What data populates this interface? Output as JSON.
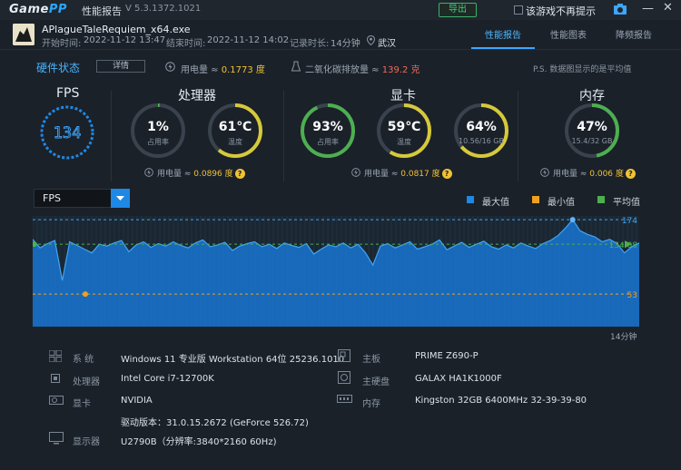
{
  "app": {
    "logo_a": "Game",
    "logo_b": "PP",
    "title": "性能报告",
    "version": "V 5.3.1372.1021"
  },
  "toolbar": {
    "export_label": "导出",
    "hide_label": "该游戏不再提示",
    "minimize": "—",
    "close": "✕"
  },
  "session": {
    "exe": "APlagueTaleRequiem_x64.exe",
    "start_label": "开始时间:",
    "start": "2022-11-12 13:47",
    "end_label": "结束时间:",
    "end": "2022-11-12 14:02",
    "duration_label": "记录时长:",
    "duration": "14分钟",
    "location": "武汉"
  },
  "tabs": [
    {
      "label": "性能报告",
      "active": true
    },
    {
      "label": "性能图表",
      "active": false
    },
    {
      "label": "降频报告",
      "active": false
    }
  ],
  "hardware": {
    "title": "硬件状态",
    "detail_btn": "详情",
    "power_label": "用电量 ≈ ",
    "power_value": "0.1773 度",
    "co2_label": "二氧化碳排放量 ≈ ",
    "co2_value": "139.2 克",
    "ps_note": "P.S. 数据图显示的是平均值"
  },
  "sections": {
    "fps": {
      "title": "FPS",
      "value": "134"
    },
    "cpu": {
      "title": "处理器",
      "usage": {
        "value": "1%",
        "label": "占用率",
        "fraction": 0.01
      },
      "temp": {
        "value": "61℃",
        "label": "温度",
        "fraction": 0.61
      },
      "power_label": "用电量 ≈ ",
      "power_value": "0.0896 度"
    },
    "gpu": {
      "title": "显卡",
      "usage": {
        "value": "93%",
        "label": "占用率",
        "fraction": 0.93
      },
      "temp": {
        "value": "59℃",
        "label": "温度",
        "fraction": 0.59
      },
      "vram": {
        "value": "64%",
        "label": "10.56/16 GB",
        "fraction": 0.64
      },
      "power_label": "用电量 ≈ ",
      "power_value": "0.0817 度"
    },
    "mem": {
      "title": "内存",
      "usage": {
        "value": "47%",
        "label": "15.4/32 GB",
        "fraction": 0.47
      },
      "power_label": "用电量 ≈ ",
      "power_value": "0.006 度"
    }
  },
  "chart_selector": {
    "value": "FPS"
  },
  "legend": [
    {
      "label": "最大值",
      "color": "#1e88e5"
    },
    {
      "label": "最小值",
      "color": "#f0a020"
    },
    {
      "label": "平均值",
      "color": "#4caf50"
    }
  ],
  "chart_data": {
    "type": "area",
    "y_axis_labels": [
      "174",
      "134.08",
      "53"
    ],
    "max": 174,
    "avg": 134.08,
    "min": 53,
    "x_end_label": "14分钟",
    "ylim": [
      0,
      180
    ],
    "values": [
      142,
      128,
      135,
      140,
      75,
      138,
      132,
      126,
      120,
      134,
      131,
      136,
      140,
      122,
      133,
      138,
      129,
      135,
      131,
      138,
      132,
      128,
      136,
      141,
      130,
      133,
      137,
      124,
      131,
      135,
      138,
      130,
      134,
      127,
      136,
      132,
      129,
      135,
      118,
      126,
      133,
      130,
      136,
      128,
      134,
      120,
      100,
      131,
      135,
      128,
      133,
      138,
      126,
      130,
      134,
      141,
      125,
      131,
      137,
      129,
      134,
      139,
      130,
      126,
      133,
      128,
      136,
      131,
      127,
      135,
      140,
      148,
      160,
      174,
      156,
      150,
      146,
      138,
      142,
      135,
      120,
      130,
      136
    ]
  },
  "system": {
    "os": {
      "label": "系 统",
      "value": "Windows 11 专业版 Workstation 64位 25236.1010"
    },
    "cpu": {
      "label": "处理器",
      "value": "Intel Core i7-12700K"
    },
    "gpu": {
      "label": "显卡",
      "value": "NVIDIA",
      "driver": "驱动版本：31.0.15.2672 (GeForce 526.72)"
    },
    "display": {
      "label": "显示器",
      "value": "U2790B（分辨率:3840*2160 60Hz)"
    },
    "board": {
      "label": "主板",
      "value": "PRIME Z690-P"
    },
    "disk": {
      "label": "主硬盘",
      "value": "GALAX HA1K1000F"
    },
    "ram": {
      "label": "内存",
      "value": "Kingston 32GB 6400MHz 32-39-39-80"
    }
  }
}
